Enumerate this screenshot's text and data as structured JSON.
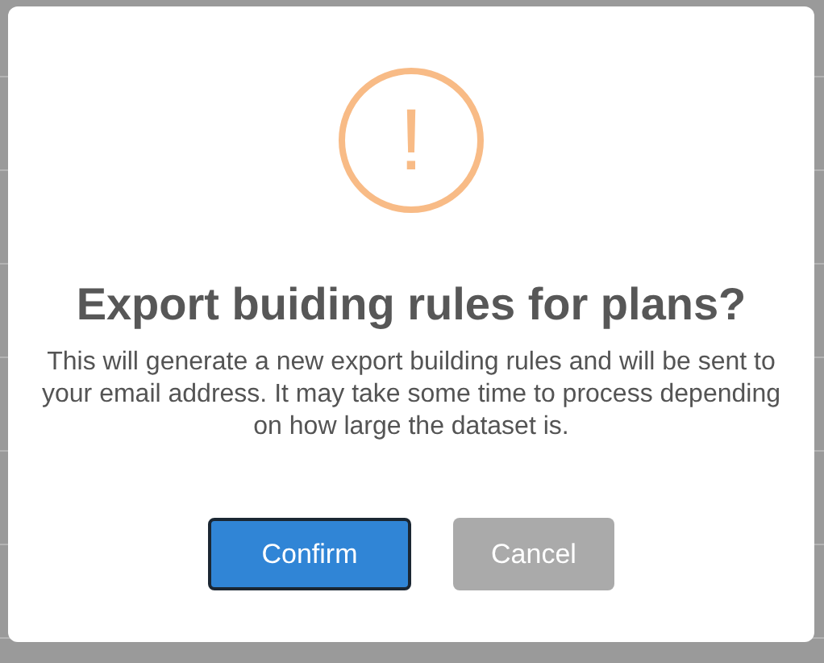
{
  "dialog": {
    "icon": "!",
    "title": "Export buiding rules for plans?",
    "message": "This will generate a new export building rules and will be sent to your email address. It may take some time to process depending on how large the dataset is.",
    "buttons": [
      {
        "label": "Confirm",
        "kind": "confirm",
        "focused": true
      },
      {
        "label": "Cancel",
        "kind": "cancel",
        "focused": false
      }
    ]
  }
}
